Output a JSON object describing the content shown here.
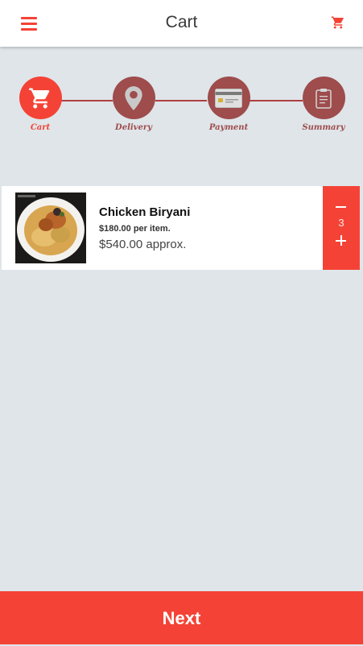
{
  "header": {
    "title": "Cart",
    "menu_icon": "menu-icon",
    "cart_icon": "cart-icon"
  },
  "steps": [
    {
      "label": "Cart",
      "icon": "cart-icon",
      "active": true
    },
    {
      "label": "Delivery",
      "icon": "location-pin-icon",
      "active": false
    },
    {
      "label": "Payment",
      "icon": "credit-card-icon",
      "active": false
    },
    {
      "label": "Summary",
      "icon": "clipboard-icon",
      "active": false
    }
  ],
  "cart_item": {
    "name": "Chicken Biryani",
    "price_per_item": "$180.00 per item.",
    "total": "$540.00 approx.",
    "quantity": "3"
  },
  "footer": {
    "next_label": "Next"
  },
  "colors": {
    "accent": "#f44336",
    "step_inactive": "#9e4c4c",
    "background": "#dfe5e9"
  }
}
